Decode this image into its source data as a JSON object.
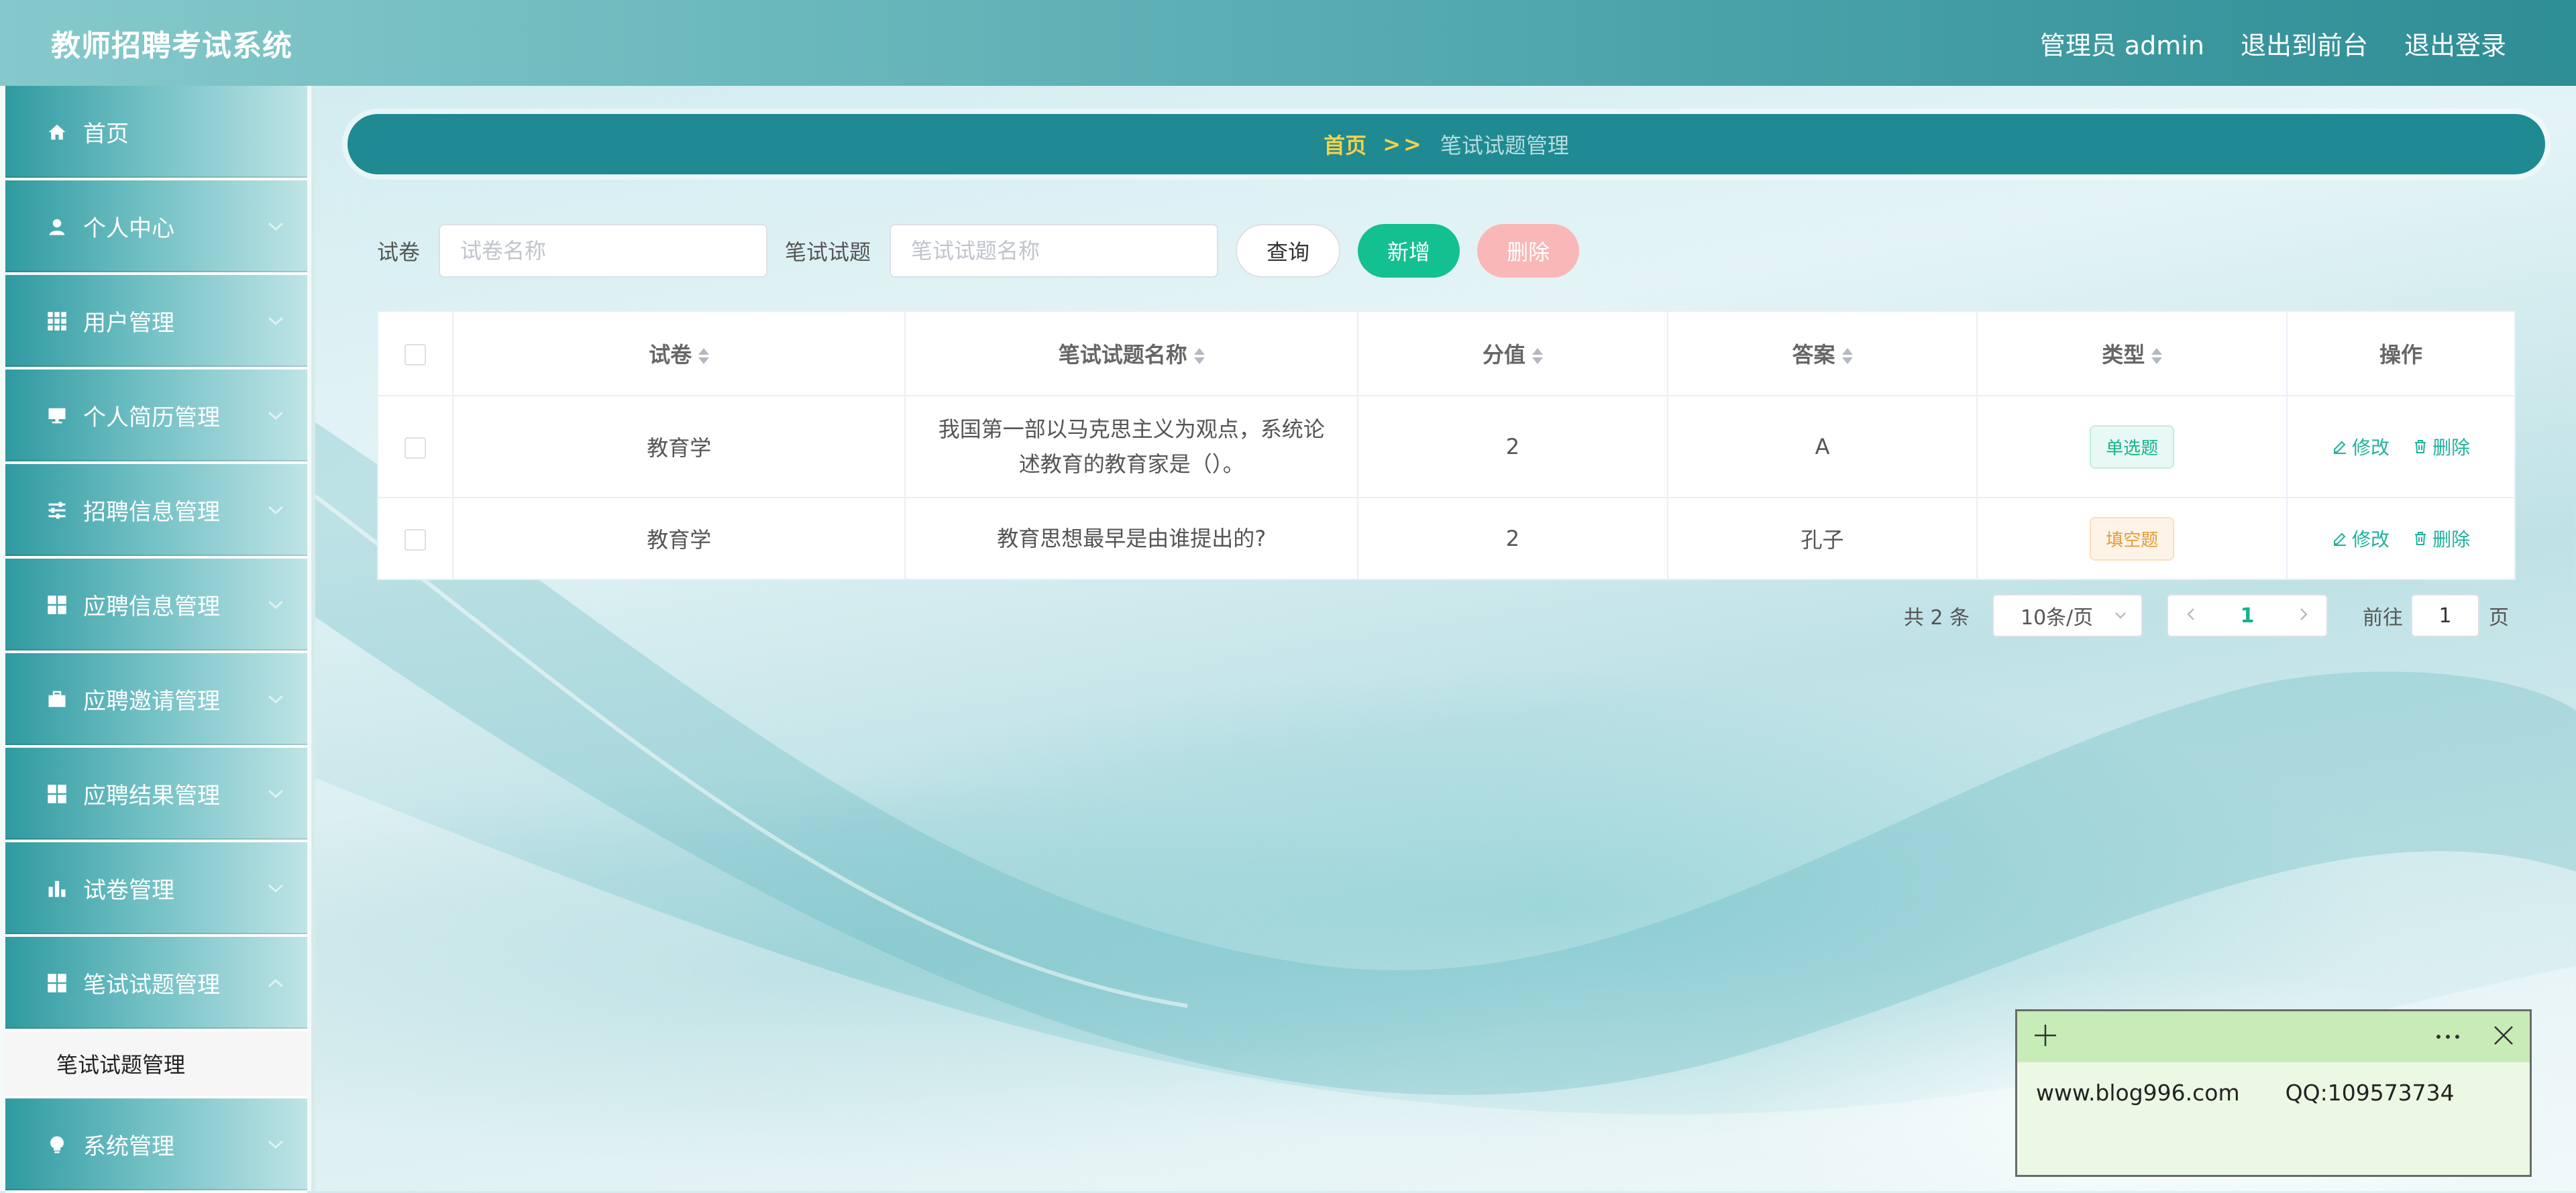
{
  "header": {
    "app_title": "教师招聘考试系统",
    "admin_label": "管理员 admin",
    "to_front_label": "退出到前台",
    "logout_label": "退出登录"
  },
  "sidebar": {
    "items": [
      {
        "label": "首页",
        "icon": "home-icon"
      },
      {
        "label": "个人中心",
        "icon": "user-icon"
      },
      {
        "label": "用户管理",
        "icon": "grid-icon"
      },
      {
        "label": "个人简历管理",
        "icon": "monitor-icon"
      },
      {
        "label": "招聘信息管理",
        "icon": "sliders-icon"
      },
      {
        "label": "应聘信息管理",
        "icon": "apps-icon"
      },
      {
        "label": "应聘邀请管理",
        "icon": "briefcase-icon"
      },
      {
        "label": "应聘结果管理",
        "icon": "apps-icon"
      },
      {
        "label": "试卷管理",
        "icon": "bar-chart-icon"
      },
      {
        "label": "笔试试题管理",
        "icon": "apps-icon"
      },
      {
        "label": "系统管理",
        "icon": "bulb-icon"
      }
    ],
    "sub_item": "笔试试题管理"
  },
  "breadcrumb": {
    "home": "首页",
    "separator": ">>",
    "current": "笔试试题管理"
  },
  "search": {
    "paper_label": "试卷",
    "paper_placeholder": "试卷名称",
    "question_label": "笔试试题",
    "question_placeholder": "笔试试题名称",
    "query_label": "查询",
    "add_label": "新增",
    "delete_label": "删除"
  },
  "table": {
    "headers": [
      "试卷",
      "笔试试题名称",
      "分值",
      "答案",
      "类型",
      "操作"
    ],
    "rows": [
      {
        "paper": "教育学",
        "question": "我国第一部以马克思主义为观点，系统论述教育的教育家是（）。",
        "score": "2",
        "answer": "A",
        "type": "单选题"
      },
      {
        "paper": "教育学",
        "question": "教育思想最早是由谁提出的?",
        "score": "2",
        "answer": "孔子",
        "type": "填空题"
      }
    ],
    "edit_label": "修改",
    "delete_label": "删除"
  },
  "pagination": {
    "total": "共 2 条",
    "page_size": "10条/页",
    "current_page": "1",
    "goto_label": "前往",
    "goto_value": "1",
    "page_unit": "页"
  },
  "note": {
    "website": "www.blog996.com",
    "qq": "QQ:109573734"
  },
  "colors": {
    "primary": "#1f8a92",
    "accent_green": "#13c08f",
    "danger_light": "#f9b7b7",
    "breadcrumb_home": "#f7d24a"
  }
}
